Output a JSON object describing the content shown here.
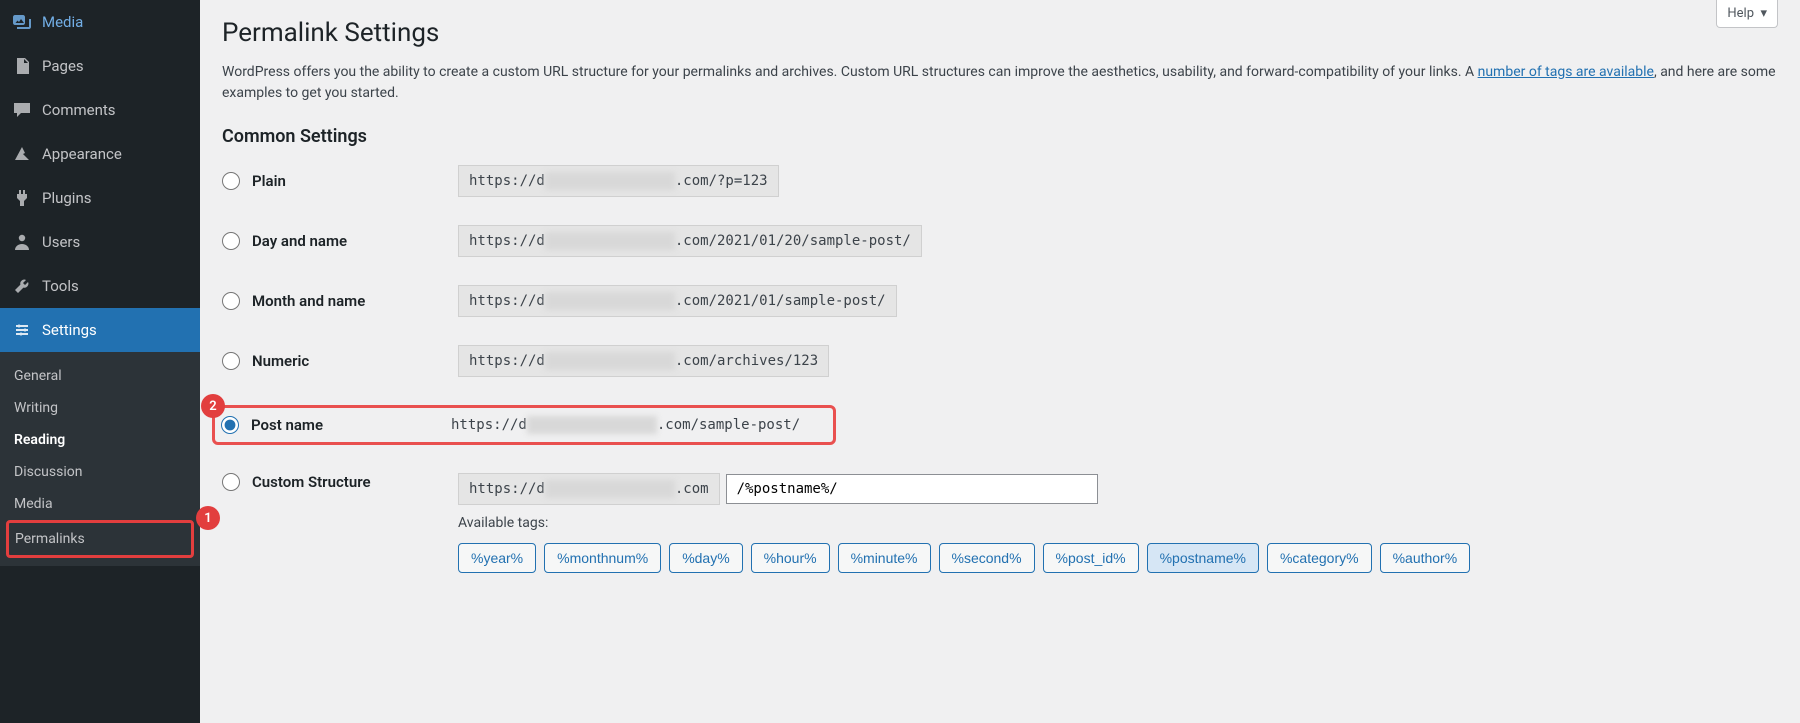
{
  "header": {
    "help": "Help"
  },
  "sidebar": {
    "items": [
      {
        "label": "Media"
      },
      {
        "label": "Pages"
      },
      {
        "label": "Comments"
      },
      {
        "label": "Appearance"
      },
      {
        "label": "Plugins"
      },
      {
        "label": "Users"
      },
      {
        "label": "Tools"
      },
      {
        "label": "Settings"
      }
    ],
    "submenu": [
      {
        "label": "General"
      },
      {
        "label": "Writing"
      },
      {
        "label": "Reading"
      },
      {
        "label": "Discussion"
      },
      {
        "label": "Media"
      },
      {
        "label": "Permalinks"
      }
    ]
  },
  "page": {
    "title": "Permalink Settings",
    "desc_pre": "WordPress offers you the ability to create a custom URL structure for your permalinks and archives. Custom URL structures can improve the aesthetics, usability, and forward-compatibility of your links. A ",
    "desc_link": "number of tags are available",
    "desc_post": ", and here are some examples to get you started.",
    "section": "Common Settings"
  },
  "options": {
    "plain": {
      "label": "Plain",
      "pre": "https://d",
      "post": ".com/?p=123"
    },
    "dayname": {
      "label": "Day and name",
      "pre": "https://d",
      "post": ".com/2021/01/20/sample-post/"
    },
    "monthname": {
      "label": "Month and name",
      "pre": "https://d",
      "post": ".com/2021/01/sample-post/"
    },
    "numeric": {
      "label": "Numeric",
      "pre": "https://d",
      "post": ".com/archives/123"
    },
    "postname": {
      "label": "Post name",
      "pre": "https://d",
      "post": ".com/sample-post/"
    },
    "custom": {
      "label": "Custom Structure",
      "pre": "https://d",
      "post": ".com",
      "value": "/%postname%/"
    }
  },
  "tags": {
    "available_label": "Available tags:",
    "list": [
      "%year%",
      "%monthnum%",
      "%day%",
      "%hour%",
      "%minute%",
      "%second%",
      "%post_id%",
      "%postname%",
      "%category%",
      "%author%"
    ]
  },
  "annotations": {
    "one": "1",
    "two": "2"
  }
}
